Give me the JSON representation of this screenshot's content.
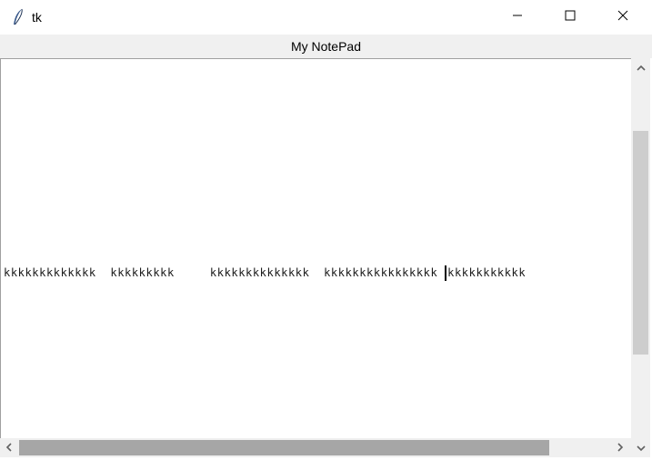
{
  "window": {
    "title": "tk",
    "icon": "feather-icon",
    "controls": [
      "minimize-icon",
      "maximize-icon",
      "close-icon"
    ]
  },
  "header": {
    "label": "My NotePad"
  },
  "editor": {
    "text_before_caret": "kkkkkkkkkkkkk  kkkkkkkkk     kkkkkkkkkkkkkk  kkkkkkkkkkkkkkkk ",
    "text_after_caret": "kkkkkkkkkkk"
  },
  "scrollbars": {
    "vertical": {
      "up_icon": "chevron-up-icon",
      "down_icon": "chevron-down-icon"
    },
    "horizontal": {
      "left_icon": "chevron-left-icon",
      "right_icon": "chevron-right-icon"
    }
  },
  "colors": {
    "chrome": "#f0f0f0",
    "v_thumb": "#cdcdcd",
    "h_thumb": "#a6a6a6"
  }
}
